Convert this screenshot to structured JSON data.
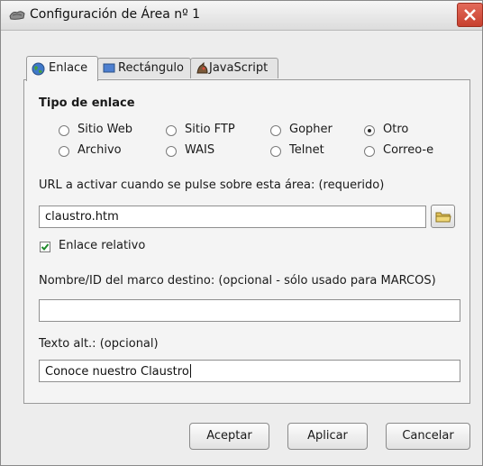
{
  "window": {
    "title": "Configuración de Área nº 1"
  },
  "tabs": [
    {
      "label": "Enlace",
      "icon": "globe-icon",
      "active": true
    },
    {
      "label": "Rectángulo",
      "icon": "rectangle-icon",
      "active": false
    },
    {
      "label": "JavaScript",
      "icon": "javascript-icon",
      "active": false
    }
  ],
  "link_type": {
    "label": "Tipo de enlace",
    "options": [
      {
        "label": "Sitio Web",
        "selected": false
      },
      {
        "label": "Sitio FTP",
        "selected": false
      },
      {
        "label": "Gopher",
        "selected": false
      },
      {
        "label": "Otro",
        "selected": true
      },
      {
        "label": "Archivo",
        "selected": false
      },
      {
        "label": "WAIS",
        "selected": false
      },
      {
        "label": "Telnet",
        "selected": false
      },
      {
        "label": "Correo-e",
        "selected": false
      }
    ]
  },
  "url": {
    "label": "URL a activar cuando se pulse sobre esta área: (requerido)",
    "value": "claustro.htm"
  },
  "relative_link": {
    "label": "Enlace relativo",
    "checked": true
  },
  "target_frame": {
    "label": "Nombre/ID del marco destino: (opcional - sólo usado para MARCOS)",
    "value": ""
  },
  "alt_text": {
    "label": "Texto alt.: (opcional)",
    "value": "Conoce nuestro Claustro"
  },
  "buttons": {
    "ok": "Aceptar",
    "apply": "Aplicar",
    "cancel": "Cancelar"
  },
  "colors": {
    "close_button": "#d14b3a",
    "check_mark": "#1f8a2b",
    "folder": "#e0c15a"
  }
}
